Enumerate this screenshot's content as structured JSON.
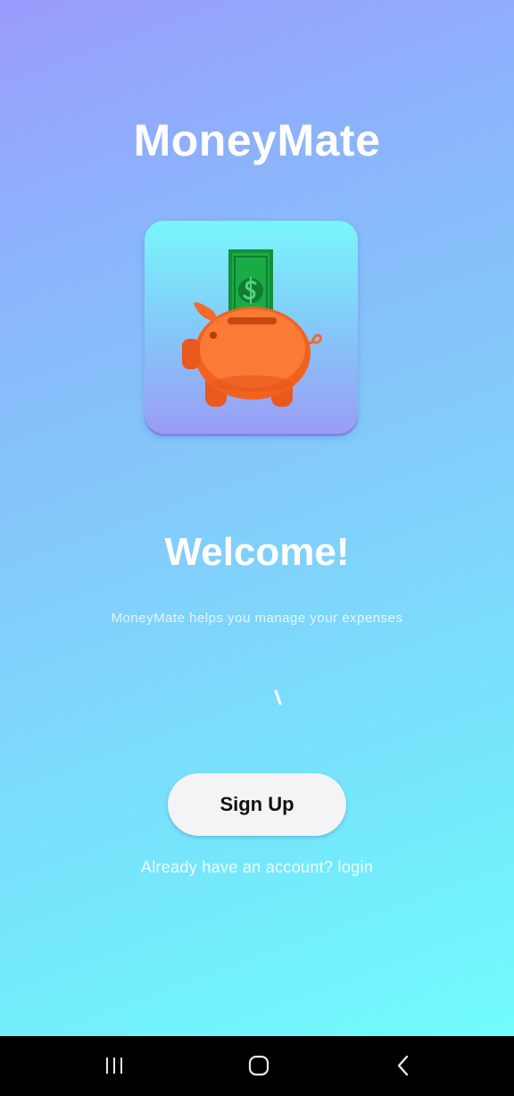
{
  "app": {
    "title": "MoneyMate",
    "logo_icon": "piggy-bank-with-dollar-bill",
    "welcome_heading": "Welcome!",
    "tagline": "MoneyMate helps you manage your expenses",
    "signup_label": "Sign Up",
    "login_prompt": "Already have an account? login"
  },
  "navbar": {
    "recent_apps_icon": "recent-apps-icon",
    "home_icon": "home-icon",
    "back_icon": "back-icon"
  },
  "colors": {
    "gradient_top": "#9a9cfd",
    "gradient_bottom": "#70fcfc",
    "piggy": "#fa6a28",
    "bill": "#17a33f",
    "button_bg": "#f4f4f6",
    "navbar_bg": "#000000"
  }
}
